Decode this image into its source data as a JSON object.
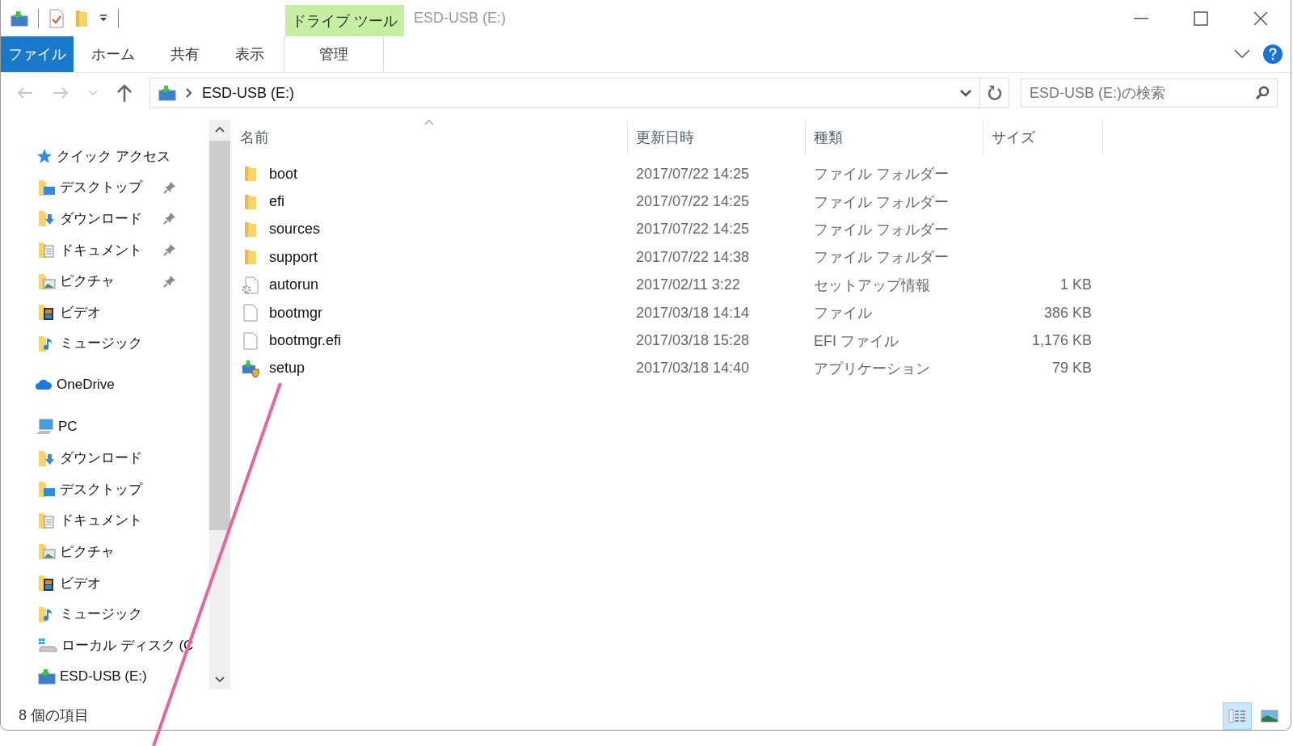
{
  "window": {
    "title": "ESD-USB (E:)",
    "context_group": "ドライブ ツール"
  },
  "ribbon": {
    "tabs": [
      {
        "label": "ファイル",
        "kind": "file"
      },
      {
        "label": "ホーム",
        "kind": "normal"
      },
      {
        "label": "共有",
        "kind": "normal"
      },
      {
        "label": "表示",
        "kind": "normal"
      },
      {
        "label": "管理",
        "kind": "contextual"
      }
    ]
  },
  "address_bar": {
    "path": "ESD-USB (E:)"
  },
  "search": {
    "placeholder": "ESD-USB (E:)の検索"
  },
  "sidebar": {
    "items": [
      {
        "label": "クイック アクセス",
        "kind": "quick",
        "children": [
          {
            "label": "デスクトップ",
            "kind": "desktop",
            "pinned": true
          },
          {
            "label": "ダウンロード",
            "kind": "downloads",
            "pinned": true
          },
          {
            "label": "ドキュメント",
            "kind": "documents",
            "pinned": true
          },
          {
            "label": "ピクチャ",
            "kind": "pictures",
            "pinned": true
          },
          {
            "label": "ビデオ",
            "kind": "videos",
            "pinned": false
          },
          {
            "label": "ミュージック",
            "kind": "music",
            "pinned": false
          }
        ]
      },
      {
        "label": "OneDrive",
        "kind": "cloud"
      },
      {
        "label": "PC",
        "kind": "pc",
        "children": [
          {
            "label": "ダウンロード",
            "kind": "downloads",
            "pinned": false
          },
          {
            "label": "デスクトップ",
            "kind": "desktop",
            "pinned": false
          },
          {
            "label": "ドキュメント",
            "kind": "documents",
            "pinned": false
          },
          {
            "label": "ピクチャ",
            "kind": "pictures",
            "pinned": false
          },
          {
            "label": "ビデオ",
            "kind": "videos",
            "pinned": false
          },
          {
            "label": "ミュージック",
            "kind": "music",
            "pinned": false
          },
          {
            "label": "ローカル ディスク (C",
            "kind": "disk",
            "pinned": false
          },
          {
            "label": "ESD-USB (E:)",
            "kind": "usb",
            "pinned": false
          }
        ]
      }
    ]
  },
  "file_list": {
    "columns": [
      "名前",
      "更新日時",
      "種類",
      "サイズ"
    ],
    "rows": [
      {
        "name": "boot",
        "modified": "2017/07/22 14:25",
        "type": "ファイル フォルダー",
        "kind": "folder"
      },
      {
        "name": "efi",
        "modified": "2017/07/22 14:25",
        "type": "ファイル フォルダー",
        "kind": "folder"
      },
      {
        "name": "sources",
        "modified": "2017/07/22 14:25",
        "type": "ファイル フォルダー",
        "kind": "folder"
      },
      {
        "name": "support",
        "modified": "2017/07/22 14:38",
        "type": "ファイル フォルダー",
        "kind": "folder"
      },
      {
        "name": "autorun",
        "modified": "2017/02/11 3:22",
        "type": "セットアップ情報",
        "size": "1 KB",
        "kind": "setup-info"
      },
      {
        "name": "bootmgr",
        "modified": "2017/03/18 14:14",
        "type": "ファイル",
        "size": "386 KB",
        "kind": "file"
      },
      {
        "name": "bootmgr.efi",
        "modified": "2017/03/18 15:28",
        "type": "EFI ファイル",
        "size": "1,176 KB",
        "kind": "file"
      },
      {
        "name": "setup",
        "modified": "2017/03/18 14:40",
        "type": "アプリケーション",
        "size": "79 KB",
        "kind": "app"
      }
    ]
  },
  "status_bar": {
    "item_count": "8 個の項目"
  },
  "view_buttons": [
    {
      "kind": "details",
      "selected": true
    },
    {
      "kind": "large-icons",
      "selected": false
    }
  ]
}
